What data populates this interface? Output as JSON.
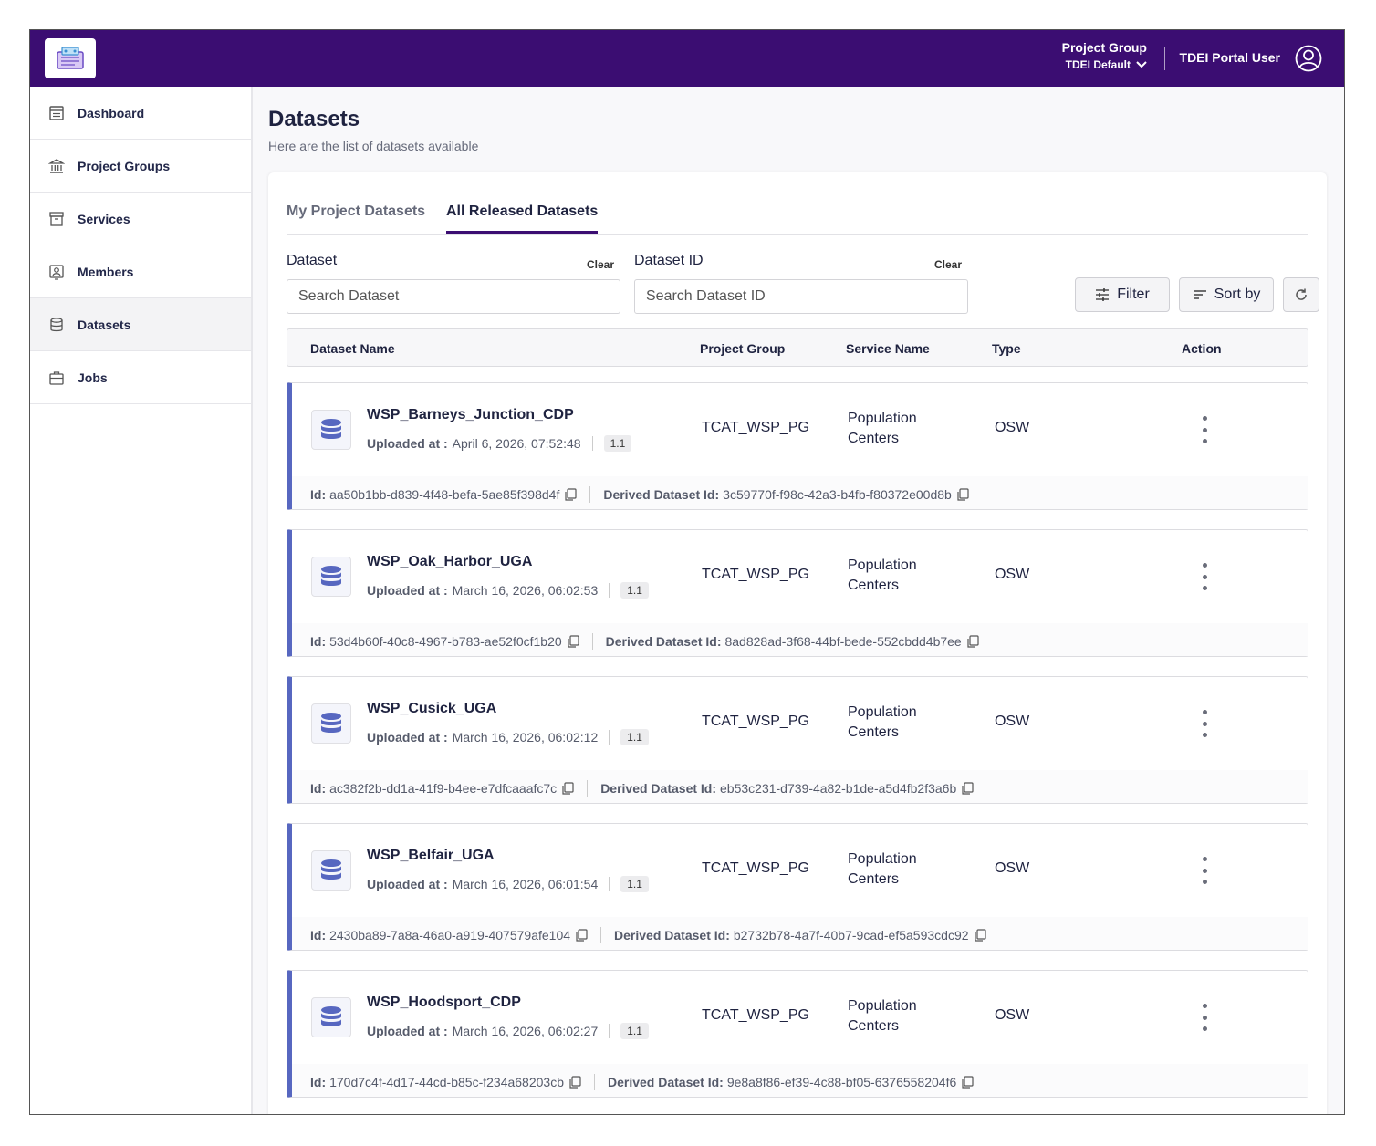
{
  "header": {
    "project_group_label": "Project Group",
    "project_group_value": "TDEI Default",
    "user_name": "TDEI Portal User"
  },
  "sidebar": {
    "items": [
      {
        "label": "Dashboard",
        "icon": "dashboard-icon"
      },
      {
        "label": "Project Groups",
        "icon": "bank-icon"
      },
      {
        "label": "Services",
        "icon": "archive-icon"
      },
      {
        "label": "Members",
        "icon": "member-icon"
      },
      {
        "label": "Datasets",
        "icon": "database-icon",
        "active": true
      },
      {
        "label": "Jobs",
        "icon": "briefcase-icon"
      }
    ]
  },
  "page": {
    "title": "Datasets",
    "subtitle": "Here are the list of datasets available"
  },
  "tabs": [
    "My Project Datasets",
    "All Released Datasets"
  ],
  "filters": {
    "dataset_label": "Dataset",
    "dataset_placeholder": "Search Dataset",
    "dataset_id_label": "Dataset ID",
    "dataset_id_placeholder": "Search Dataset ID",
    "clear_label": "Clear",
    "filter_label": "Filter",
    "sort_label": "Sort by"
  },
  "table": {
    "columns": [
      "Dataset Name",
      "Project Group",
      "Service Name",
      "Type",
      "Action"
    ],
    "uploaded_label": "Uploaded at :",
    "id_label": "Id:",
    "derived_label": "Derived Dataset Id:",
    "rows": [
      {
        "name": "WSP_Barneys_Junction_CDP",
        "uploaded": "April 6, 2026, 07:52:48",
        "version": "1.1",
        "project_group": "TCAT_WSP_PG",
        "service_line1": "Population",
        "service_line2": "Centers",
        "type": "OSW",
        "id": "aa50b1bb-d839-4f48-befa-5ae85f398d4f",
        "derived_id": "3c59770f-f98c-42a3-b4fb-f80372e00d8b"
      },
      {
        "name": "WSP_Oak_Harbor_UGA",
        "uploaded": "March 16, 2026, 06:02:53",
        "version": "1.1",
        "project_group": "TCAT_WSP_PG",
        "service_line1": "Population",
        "service_line2": "Centers",
        "type": "OSW",
        "id": "53d4b60f-40c8-4967-b783-ae52f0cf1b20",
        "derived_id": "8ad828ad-3f68-44bf-bede-552cbdd4b7ee"
      },
      {
        "name": "WSP_Cusick_UGA",
        "uploaded": "March 16, 2026, 06:02:12",
        "version": "1.1",
        "project_group": "TCAT_WSP_PG",
        "service_line1": "Population",
        "service_line2": "Centers",
        "type": "OSW",
        "id": "ac382f2b-dd1a-41f9-b4ee-e7dfcaaafc7c",
        "derived_id": "eb53c231-d739-4a82-b1de-a5d4fb2f3a6b"
      },
      {
        "name": "WSP_Belfair_UGA",
        "uploaded": "March 16, 2026, 06:01:54",
        "version": "1.1",
        "project_group": "TCAT_WSP_PG",
        "service_line1": "Population",
        "service_line2": "Centers",
        "type": "OSW",
        "id": "2430ba89-7a8a-46a0-a919-407579afe104",
        "derived_id": "b2732b78-4a7f-40b7-9cad-ef5a593cdc92"
      },
      {
        "name": "WSP_Hoodsport_CDP",
        "uploaded": "March 16, 2026, 06:02:27",
        "version": "1.1",
        "project_group": "TCAT_WSP_PG",
        "service_line1": "Population",
        "service_line2": "Centers",
        "type": "OSW",
        "id": "170d7c4f-4d17-44cd-b85c-f234a68203cb",
        "derived_id": "9e8a8f86-ef39-4c88-bf05-6376558204f6"
      }
    ]
  },
  "colors": {
    "topbar": "#3b0d72",
    "accent": "#5767c0"
  }
}
